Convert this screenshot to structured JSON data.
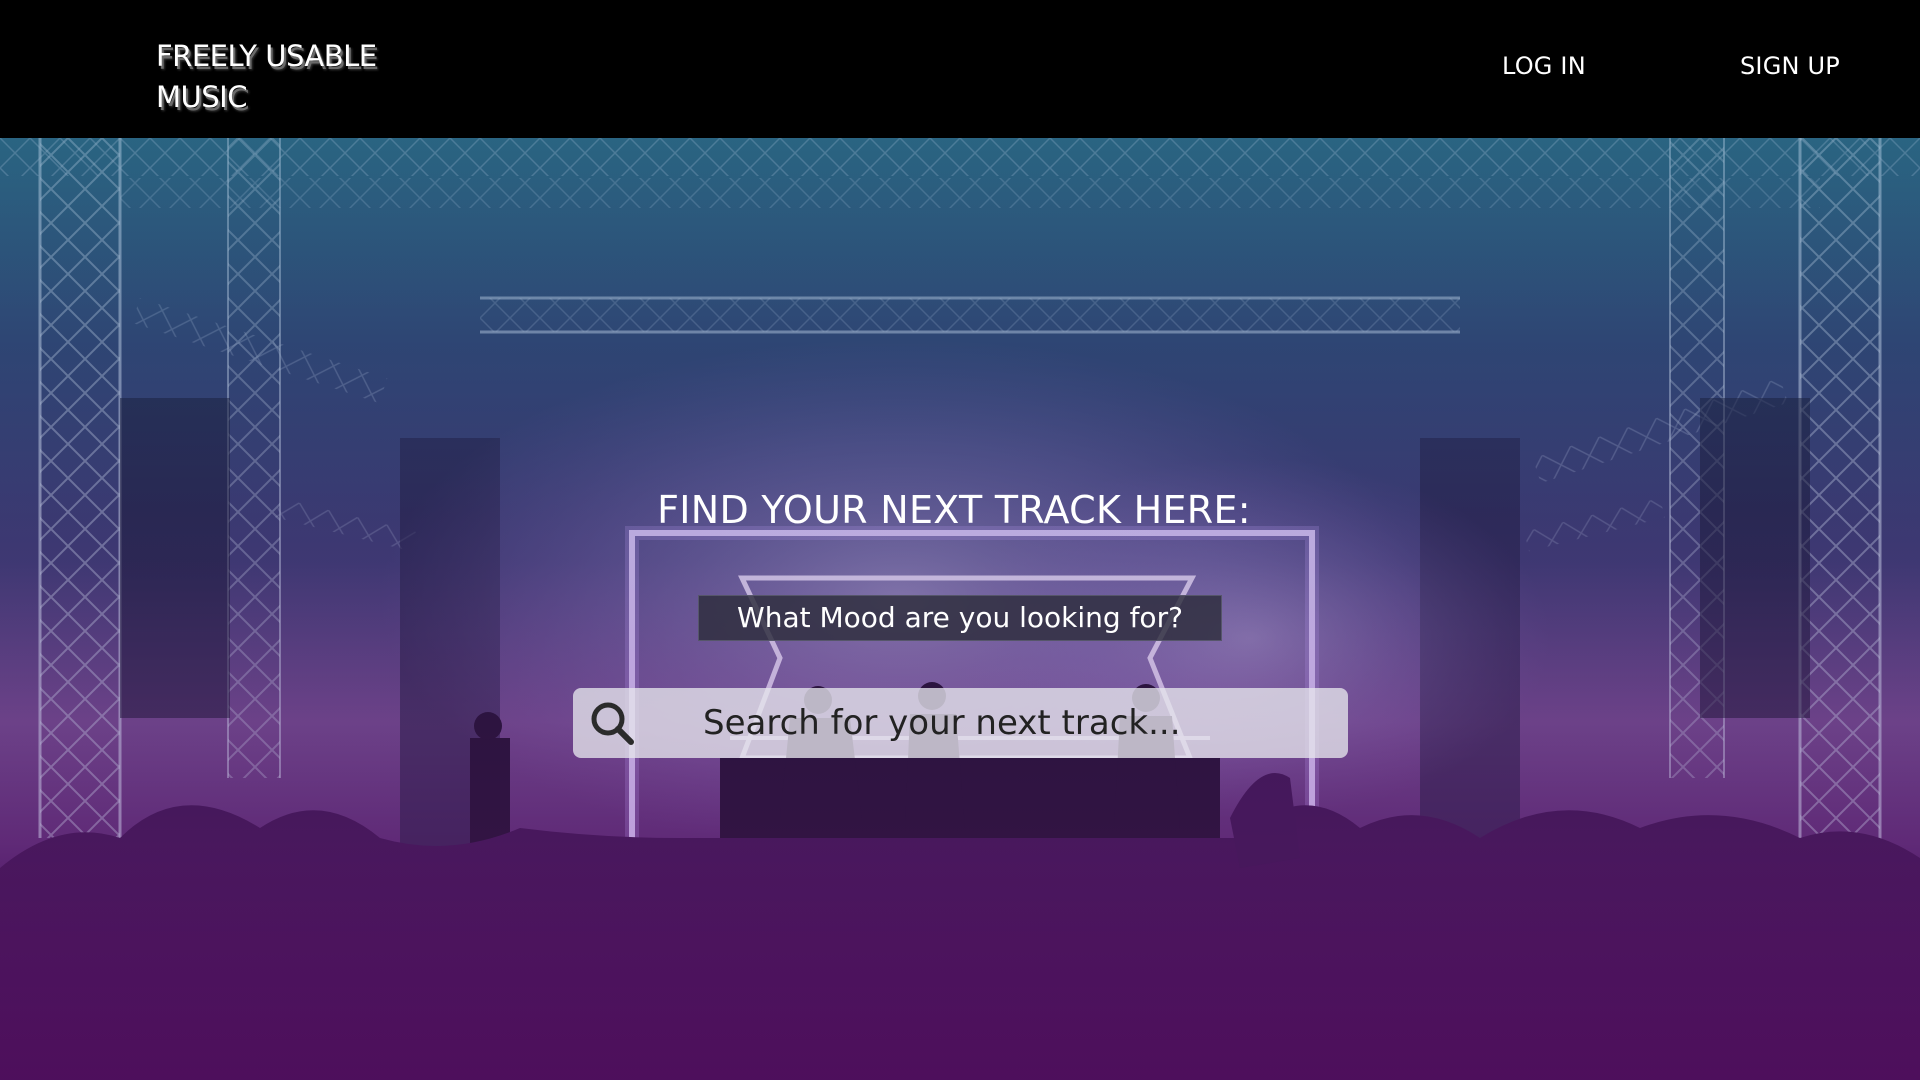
{
  "header": {
    "brand_line1": "FREELY USABLE",
    "brand_line2": "MUSIC",
    "login_label": "LOG IN",
    "signup_label": "SIGN UP"
  },
  "hero": {
    "headline": "FIND YOUR NEXT TRACK HERE:",
    "mood_prompt": "What Mood are you looking for?",
    "search": {
      "placeholder": "Search for your next track...",
      "icon": "search-icon"
    },
    "background": "concert-stage-photo"
  },
  "colors": {
    "header_bg": "#000000",
    "gradient_top": "#2c5f7c",
    "gradient_bottom": "#4c1257",
    "text": "#ffffff"
  }
}
